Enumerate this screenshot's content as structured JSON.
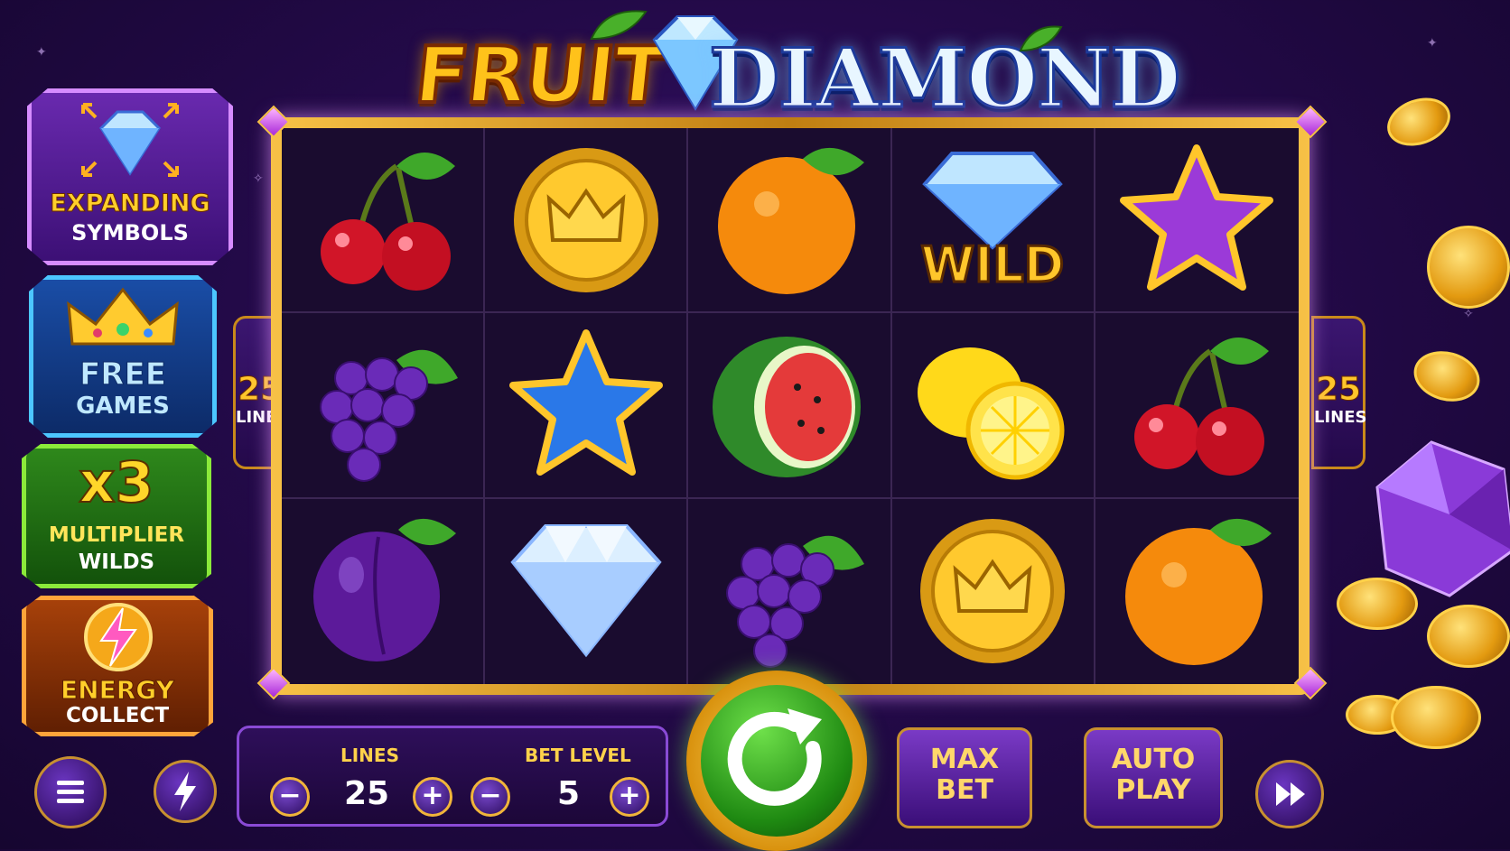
{
  "title": {
    "part1": "FRUIT",
    "part2": "DIAMOND"
  },
  "features": [
    {
      "line1": "EXPANDING",
      "line2": "SYMBOLS",
      "icon": "diamond-expand-icon"
    },
    {
      "line1": "FREE",
      "line2": "GAMES",
      "icon": "crown-icon"
    },
    {
      "line1": "x3",
      "line2": "MULTIPLIER",
      "line3": "WILDS",
      "icon": "multiplier-icon"
    },
    {
      "line1": "ENERGY",
      "line2": "COLLECT",
      "icon": "lightning-coin-icon"
    }
  ],
  "paylines": {
    "count": "25",
    "label": "LINES"
  },
  "reels": {
    "rows": [
      [
        "cherry",
        "crown-coin",
        "orange",
        "diamond-wild",
        "purple-star"
      ],
      [
        "grapes",
        "blue-star",
        "watermelon",
        "lemon",
        "cherry"
      ],
      [
        "plum",
        "diamond",
        "grapes",
        "crown-coin",
        "orange"
      ]
    ],
    "wild_label": "WILD"
  },
  "controls": {
    "lines_label": "LINES",
    "lines_value": "25",
    "bet_level_label": "BET LEVEL",
    "bet_level_value": "5",
    "minus": "−",
    "plus": "+",
    "max_bet": [
      "MAX",
      "BET"
    ],
    "auto_play": [
      "AUTO",
      "PLAY"
    ]
  },
  "colors": {
    "gold": "#f7c146",
    "purple": "#3a1470",
    "green": "#1f8a12"
  }
}
